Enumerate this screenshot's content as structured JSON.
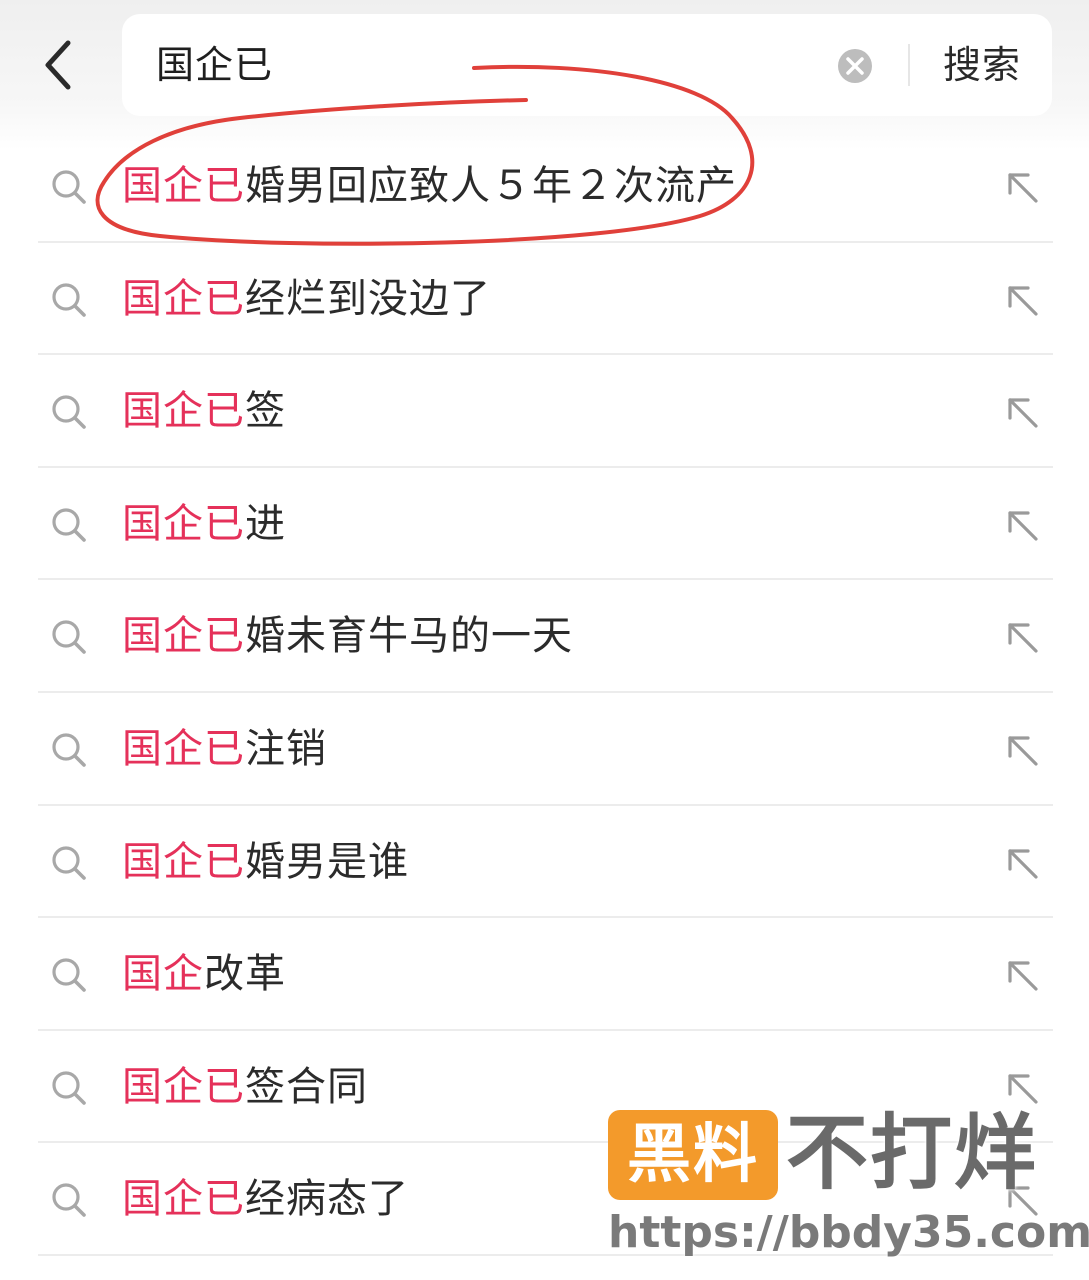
{
  "search": {
    "value": "国企已",
    "submit_label": "搜索"
  },
  "colors": {
    "highlight": "#e5315a",
    "text": "#2b2b2b",
    "annotation_circle": "#e0403a",
    "watermark_badge": "#f39a2b"
  },
  "icons": {
    "back": "chevron-left-icon",
    "clear": "clear-circle-icon",
    "row_search": "search-icon",
    "row_fill": "arrow-up-left-icon"
  },
  "suggestions": [
    {
      "highlight": "国企已",
      "rest": "婚男回应致人５年２次流产"
    },
    {
      "highlight": "国企已",
      "rest": "经烂到没边了"
    },
    {
      "highlight": "国企已",
      "rest": "签"
    },
    {
      "highlight": "国企已",
      "rest": "进"
    },
    {
      "highlight": "国企已",
      "rest": "婚未育牛马的一天"
    },
    {
      "highlight": "国企已",
      "rest": "注销"
    },
    {
      "highlight": "国企已",
      "rest": "婚男是谁"
    },
    {
      "highlight": "国企",
      "rest": "改革"
    },
    {
      "highlight": "国企已",
      "rest": "签合同"
    },
    {
      "highlight": "国企已",
      "rest": "经病态了"
    }
  ],
  "watermark": {
    "badge": "黑料",
    "title": "不打烊",
    "url": "https://bbdy35.com"
  }
}
